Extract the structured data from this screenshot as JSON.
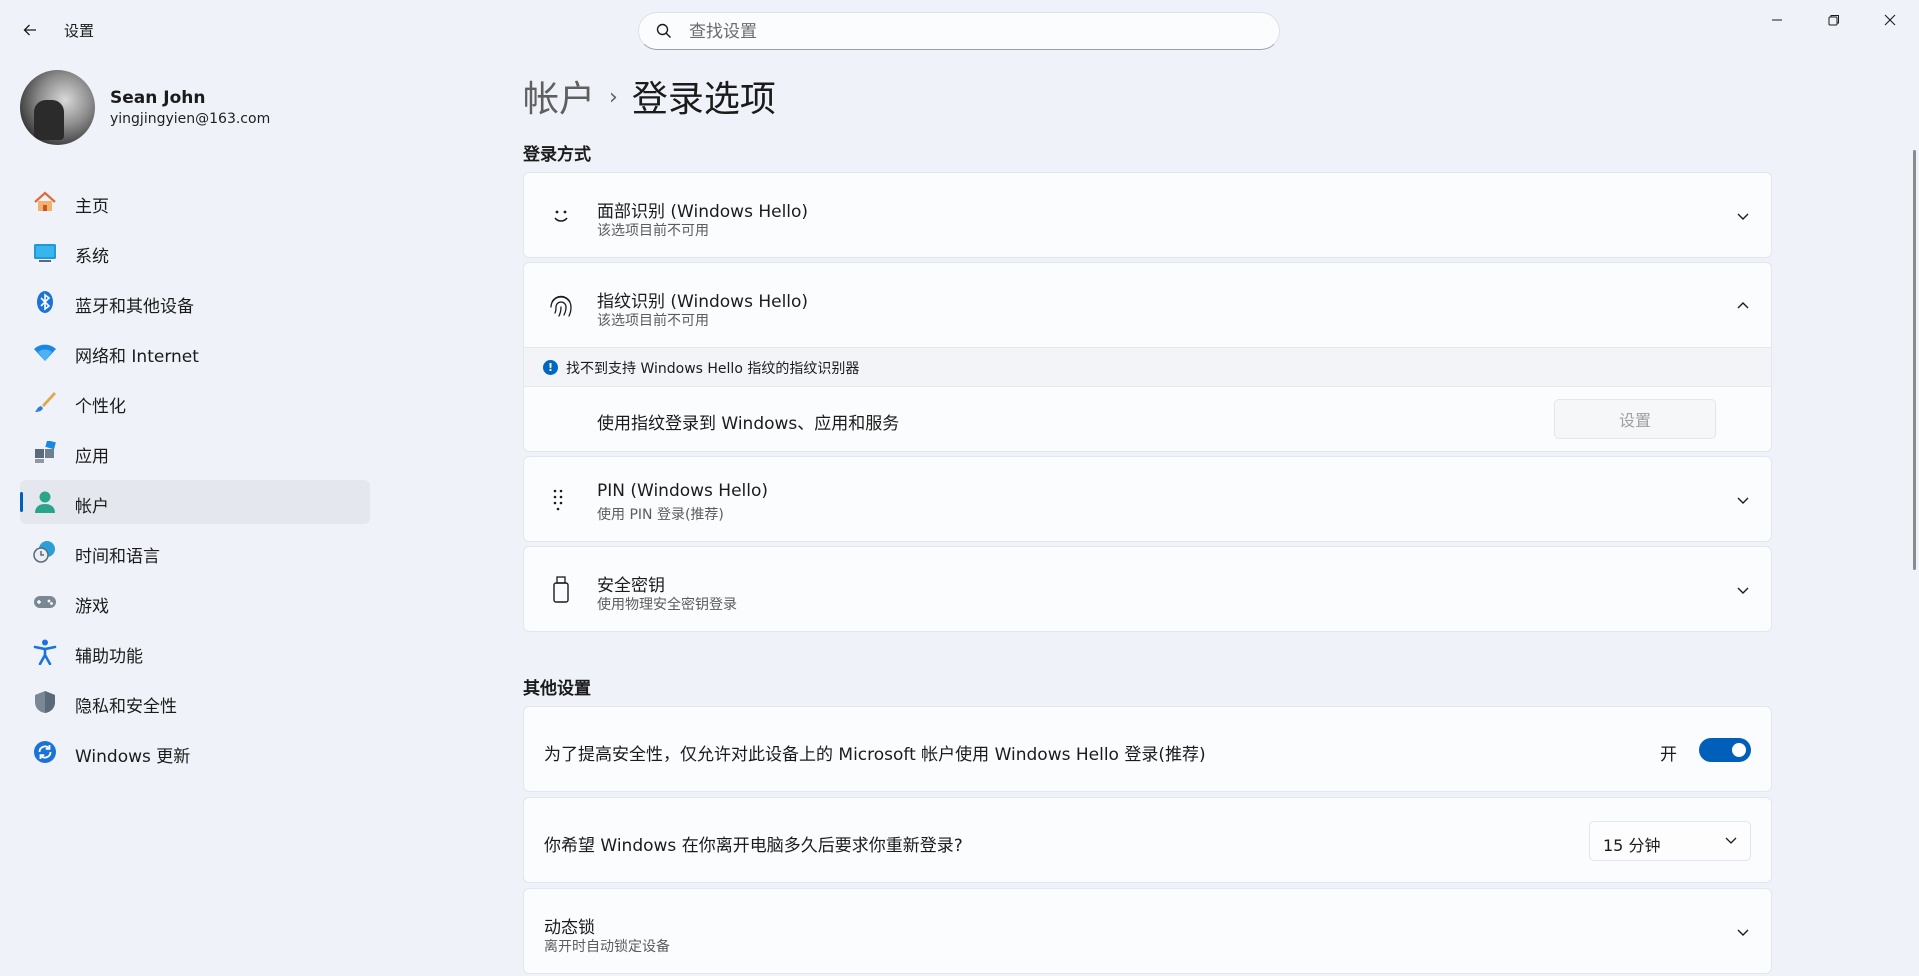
{
  "window": {
    "app_title": "设置",
    "search_placeholder": "查找设置"
  },
  "user": {
    "name": "Sean John",
    "email": "yingjingyien@163.com"
  },
  "sidebar": {
    "items": [
      {
        "label": "主页",
        "icon": "home-icon"
      },
      {
        "label": "系统",
        "icon": "system-icon"
      },
      {
        "label": "蓝牙和其他设备",
        "icon": "bluetooth-icon"
      },
      {
        "label": "网络和 Internet",
        "icon": "wifi-icon"
      },
      {
        "label": "个性化",
        "icon": "brush-icon"
      },
      {
        "label": "应用",
        "icon": "apps-icon"
      },
      {
        "label": "帐户",
        "icon": "account-icon",
        "active": true
      },
      {
        "label": "时间和语言",
        "icon": "globe-clock-icon"
      },
      {
        "label": "游戏",
        "icon": "gamepad-icon"
      },
      {
        "label": "辅助功能",
        "icon": "accessibility-icon"
      },
      {
        "label": "隐私和安全性",
        "icon": "shield-icon"
      },
      {
        "label": "Windows 更新",
        "icon": "update-icon"
      }
    ]
  },
  "breadcrumb": {
    "parent": "帐户",
    "separator": "›",
    "current": "登录选项"
  },
  "signin_methods": {
    "title": "登录方式",
    "face": {
      "title": "面部识别 (Windows Hello)",
      "subtitle": "该选项目前不可用"
    },
    "fingerprint": {
      "title": "指纹识别 (Windows Hello)",
      "subtitle": "该选项目前不可用",
      "info": "找不到支持 Windows Hello 指纹的指纹识别器",
      "row_label": "使用指纹登录到 Windows、应用和服务",
      "setup_button": "设置"
    },
    "pin": {
      "title": "PIN (Windows Hello)",
      "subtitle": "使用 PIN 登录(推荐)"
    },
    "security_key": {
      "title": "安全密钥",
      "subtitle": "使用物理安全密钥登录"
    }
  },
  "other_settings": {
    "title": "其他设置",
    "hello_only": {
      "label": "为了提高安全性，仅允许对此设备上的 Microsoft 帐户使用 Windows Hello 登录(推荐)",
      "state_label": "开",
      "on": true
    },
    "require_signin": {
      "label": "你希望 Windows 在你离开电脑多久后要求你重新登录?",
      "value": "15 分钟"
    },
    "dynamic_lock": {
      "title": "动态锁",
      "subtitle": "离开时自动锁定设备"
    }
  },
  "colors": {
    "accent": "#005fb8",
    "background": "#eff3f9",
    "card": "#fbfcfe"
  }
}
